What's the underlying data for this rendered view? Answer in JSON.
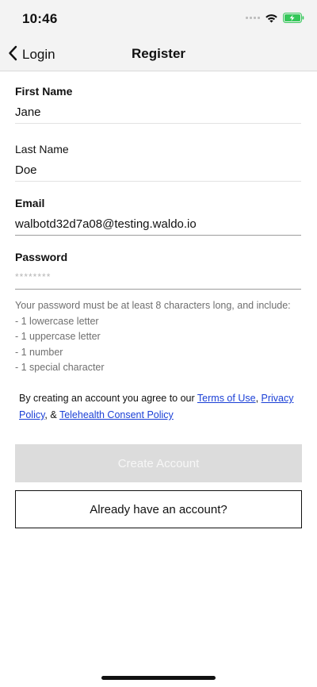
{
  "status_bar": {
    "time": "10:46"
  },
  "nav": {
    "back_label": "Login",
    "title": "Register"
  },
  "form": {
    "first_name": {
      "label": "First Name",
      "value": "Jane"
    },
    "last_name": {
      "label": "Last Name",
      "value": "Doe"
    },
    "email": {
      "label": "Email",
      "value": "walbotd32d7a08@testing.waldo.io"
    },
    "password": {
      "label": "Password",
      "value": "********"
    }
  },
  "password_rules": {
    "intro": "Your password must be at least 8 characters long, and include:",
    "items": [
      "- 1 lowercase letter",
      "- 1 uppercase letter",
      "- 1 number",
      "- 1 special character"
    ]
  },
  "terms": {
    "prefix": "By creating an account you agree to our ",
    "link_terms": "Terms of Use",
    "sep1": ", ",
    "link_privacy": "Privacy Policy",
    "sep2": ", & ",
    "link_telehealth": "Telehealth Consent Policy"
  },
  "buttons": {
    "create_account": "Create Account",
    "already_have_account": "Already have an account?"
  },
  "colors": {
    "link": "#1a3fd6",
    "disabled_button": "#dcdcdc",
    "battery_charging": "#34c759"
  },
  "icons": [
    "signal-icon",
    "wifi-icon",
    "battery-icon",
    "chevron-left-icon"
  ]
}
